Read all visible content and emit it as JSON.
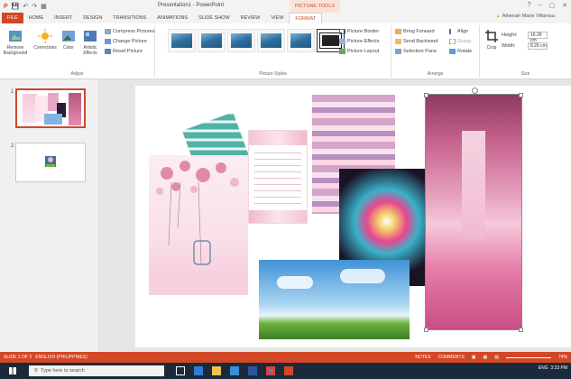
{
  "window": {
    "title": "Presentation1 - PowerPoint",
    "context_title": "PICTURE TOOLS",
    "help": "?",
    "minimize": "–",
    "restore": "▢",
    "close": "✕"
  },
  "qat": {
    "undo": "↶",
    "redo": "↷"
  },
  "tabs": [
    "FILE",
    "HOME",
    "INSERT",
    "DESIGN",
    "TRANSITIONS",
    "ANIMATIONS",
    "SLIDE SHOW",
    "REVIEW",
    "VIEW",
    "FORMAT"
  ],
  "user": "Athenah Marie Villarosa",
  "ribbon": {
    "adjust": {
      "label": "Adjust",
      "remove_bg": "Remove Background",
      "corrections": "Corrections",
      "color": "Color",
      "artistic": "Artistic Effects",
      "compress": "Compress Pictures",
      "change": "Change Picture",
      "reset": "Reset Picture"
    },
    "styles": {
      "label": "Picture Styles",
      "border": "Picture Border",
      "effects": "Picture Effects",
      "layout": "Picture Layout"
    },
    "arrange": {
      "label": "Arrange",
      "forward": "Bring Forward",
      "backward": "Send Backward",
      "pane": "Selection Pane",
      "align": "Align",
      "group": "Group",
      "rotate": "Rotate"
    },
    "size": {
      "label": "Size",
      "crop": "Crop",
      "height_label": "Height:",
      "height": "16.26 cm",
      "width_label": "Width:",
      "width": "8.26 cm"
    }
  },
  "slides": [
    {
      "num": "1"
    },
    {
      "num": "2"
    }
  ],
  "status": {
    "slide": "SLIDE 1 OF 2",
    "language": "ENGLISH (PHILIPPINES)",
    "notes": "NOTES",
    "comments": "COMMENTS",
    "zoom": "74%"
  },
  "taskbar": {
    "search": "Type here to search",
    "time": "3:33 PM",
    "lang": "ENG"
  },
  "colors": {
    "accent": "#d24726",
    "taskbar": "#1b2a3a"
  }
}
